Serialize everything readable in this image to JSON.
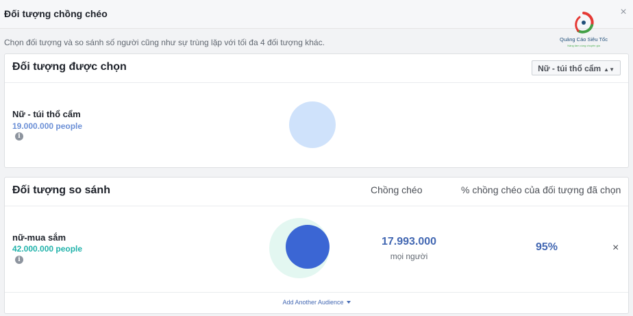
{
  "dialog": {
    "title": "Đối tượng chồng chéo",
    "subtitle": "Chọn đối tượng và so sánh số người cũng như sự trùng lặp với tối đa 4 đối tượng khác.",
    "close_icon": "×"
  },
  "logo": {
    "name": "Quảng Cáo Siêu Tốc",
    "tagline": "Nâng tầm cùng chuyên gia"
  },
  "selected_section": {
    "heading": "Đối tượng được chọn",
    "dropdown_value": "Nữ - túi thổ cẩm",
    "audience": {
      "name": "Nữ - túi thổ cẩm",
      "count": "19.000.000 people",
      "color": "#cfe2fb"
    }
  },
  "compare_section": {
    "heading": "Đối tượng so sánh",
    "col_overlap": "Chồng chéo",
    "col_percent": "% chồng chéo của đối tượng đã chọn",
    "rows": [
      {
        "name": "nữ-mua sắm",
        "count": "42.000.000 people",
        "count_color": "#20b2aa",
        "overlap_value": "17.993.000",
        "overlap_unit": "mọi người",
        "percent": "95%",
        "remove_icon": "×"
      }
    ],
    "add_audience_label": "Add Another Audience"
  },
  "colors": {
    "accent": "#4267b2",
    "selected_circle": "#cfe2fb",
    "compare_circle": "#e3f7f1",
    "overlap_circle": "#3b66d4",
    "selected_count": "#6b8fd6",
    "compare_count": "#20b2aa"
  }
}
